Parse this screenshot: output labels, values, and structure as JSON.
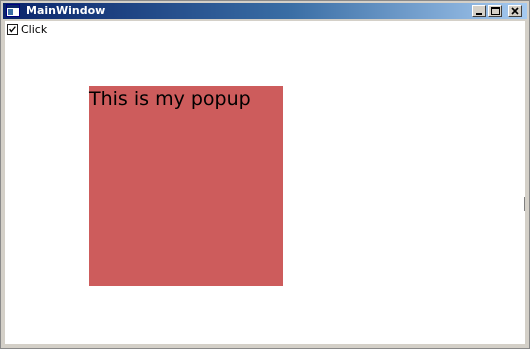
{
  "window": {
    "title": "MainWindow",
    "icon": "app-window-icon",
    "controls": [
      "minimize-icon",
      "maximize-icon",
      "close-icon"
    ]
  },
  "content": {
    "checkbox_label": "Click",
    "checkbox_checked": true
  },
  "popup": {
    "text": "This is my popup",
    "background": "#cd5c5c"
  },
  "colors": {
    "titlebar_start": "#0a246a",
    "titlebar_end": "#a6caf0",
    "client_bg": "#ffffff"
  }
}
